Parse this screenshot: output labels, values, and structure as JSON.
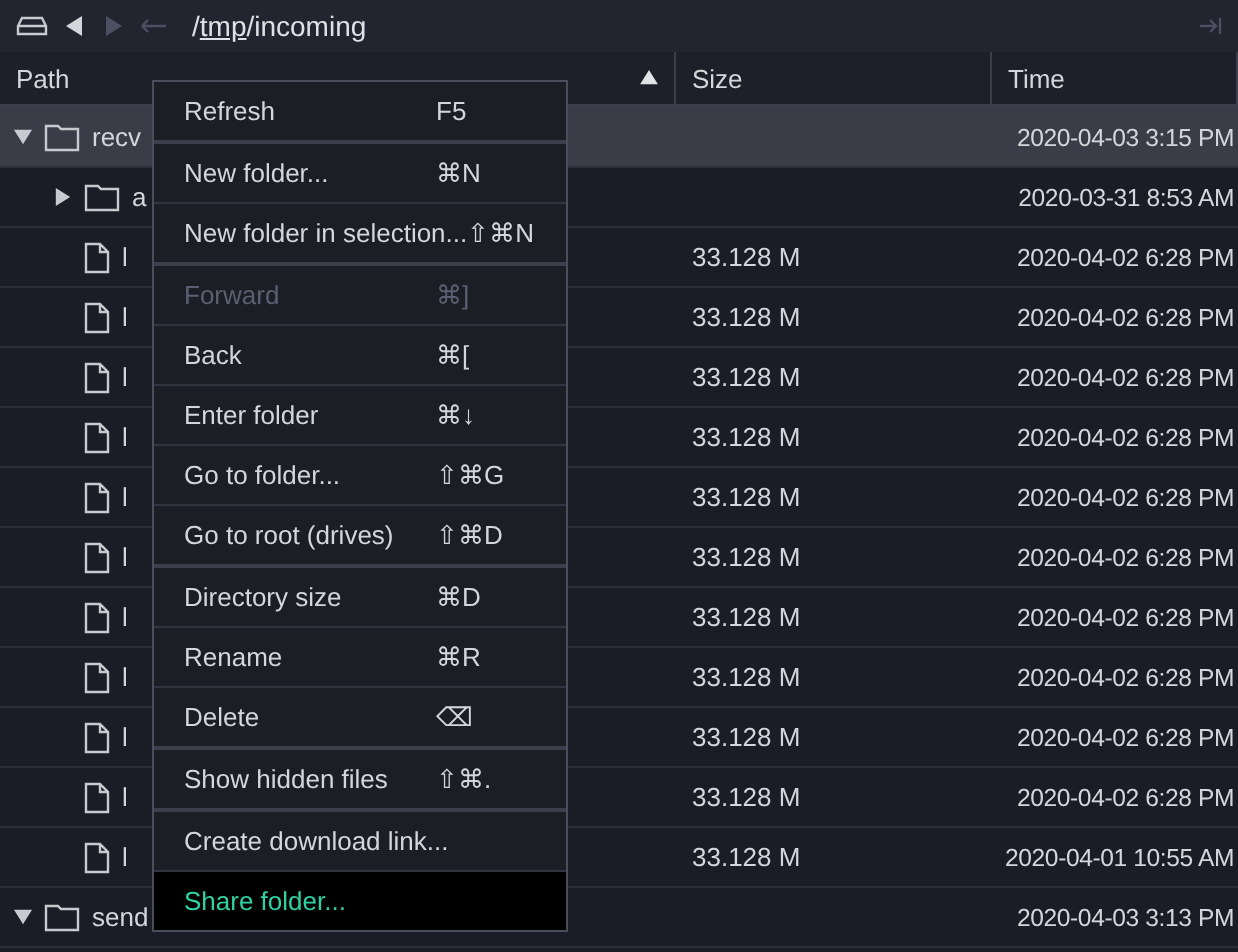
{
  "toolbar": {
    "back_enabled": true,
    "forward_enabled": false,
    "up_enabled": false,
    "path": [
      {
        "text": "/",
        "underlined": false
      },
      {
        "text": "tmp",
        "underlined": true
      },
      {
        "text": "/incoming",
        "underlined": false
      }
    ]
  },
  "columns": [
    {
      "label": "Path",
      "sorted": true
    },
    {
      "label": "Size",
      "sorted": false
    },
    {
      "label": "Time",
      "sorted": false
    }
  ],
  "rows": [
    {
      "kind": "folder",
      "name": "recv",
      "time": "2020-04-03 3:15 PM",
      "selected": true,
      "expanded": true,
      "children": [
        {
          "kind": "folder",
          "name": "a",
          "time": "2020-03-31 8:53 AM",
          "selected": false,
          "expanded": false
        },
        {
          "kind": "file",
          "name": "l",
          "size": "33.128 M",
          "time": "2020-04-02 6:28 PM",
          "selected": false
        },
        {
          "kind": "file",
          "name": "l",
          "size": "33.128 M",
          "time": "2020-04-02 6:28 PM",
          "selected": false
        },
        {
          "kind": "file",
          "name": "l",
          "size": "33.128 M",
          "time": "2020-04-02 6:28 PM",
          "selected": false
        },
        {
          "kind": "file",
          "name": "l",
          "size": "33.128 M",
          "time": "2020-04-02 6:28 PM",
          "selected": false
        },
        {
          "kind": "file",
          "name": "l",
          "size": "33.128 M",
          "time": "2020-04-02 6:28 PM",
          "selected": false
        },
        {
          "kind": "file",
          "name": "l",
          "size": "33.128 M",
          "time": "2020-04-02 6:28 PM",
          "selected": false
        },
        {
          "kind": "file",
          "name": "l",
          "size": "33.128 M",
          "time": "2020-04-02 6:28 PM",
          "selected": false
        },
        {
          "kind": "file",
          "name": "l",
          "size": "33.128 M",
          "time": "2020-04-02 6:28 PM",
          "selected": false
        },
        {
          "kind": "file",
          "name": "l",
          "size": "33.128 M",
          "time": "2020-04-02 6:28 PM",
          "selected": false
        },
        {
          "kind": "file",
          "name": "l",
          "size": "33.128 M",
          "time": "2020-04-02 6:28 PM",
          "selected": false
        },
        {
          "kind": "file",
          "name": "l",
          "size": "33.128 M",
          "time": "2020-04-01 10:55 AM",
          "selected": false
        }
      ]
    },
    {
      "kind": "folder",
      "name": "send",
      "time": "2020-04-03 3:13 PM",
      "selected": false,
      "expanded": true
    }
  ],
  "context_menu": {
    "groups": [
      [
        {
          "label": "Refresh",
          "shortcut": "F5",
          "disabled": false,
          "highlighted": false
        }
      ],
      [
        {
          "label": "New folder...",
          "shortcut": "⌘N",
          "disabled": false,
          "highlighted": false
        },
        {
          "label": "New folder in selection...",
          "shortcut": "⇧⌘N",
          "disabled": false,
          "highlighted": false
        }
      ],
      [
        {
          "label": "Forward",
          "shortcut": "⌘]",
          "disabled": true,
          "highlighted": false
        },
        {
          "label": "Back",
          "shortcut": "⌘[",
          "disabled": false,
          "highlighted": false
        },
        {
          "label": "Enter folder",
          "shortcut": "⌘↓",
          "disabled": false,
          "highlighted": false
        },
        {
          "label": "Go to folder...",
          "shortcut": "⇧⌘G",
          "disabled": false,
          "highlighted": false
        },
        {
          "label": "Go to root (drives)",
          "shortcut": "⇧⌘D",
          "disabled": false,
          "highlighted": false
        }
      ],
      [
        {
          "label": "Directory size",
          "shortcut": "⌘D",
          "disabled": false,
          "highlighted": false
        },
        {
          "label": "Rename",
          "shortcut": "⌘R",
          "disabled": false,
          "highlighted": false
        },
        {
          "label": "Delete",
          "shortcut": "⌫",
          "disabled": false,
          "highlighted": false
        }
      ],
      [
        {
          "label": "Show hidden files",
          "shortcut": "⇧⌘.",
          "disabled": false,
          "highlighted": false
        }
      ],
      [
        {
          "label": "Create download link...",
          "disabled": false,
          "highlighted": false
        },
        {
          "label": "Share folder...",
          "disabled": false,
          "highlighted": true
        }
      ]
    ]
  }
}
